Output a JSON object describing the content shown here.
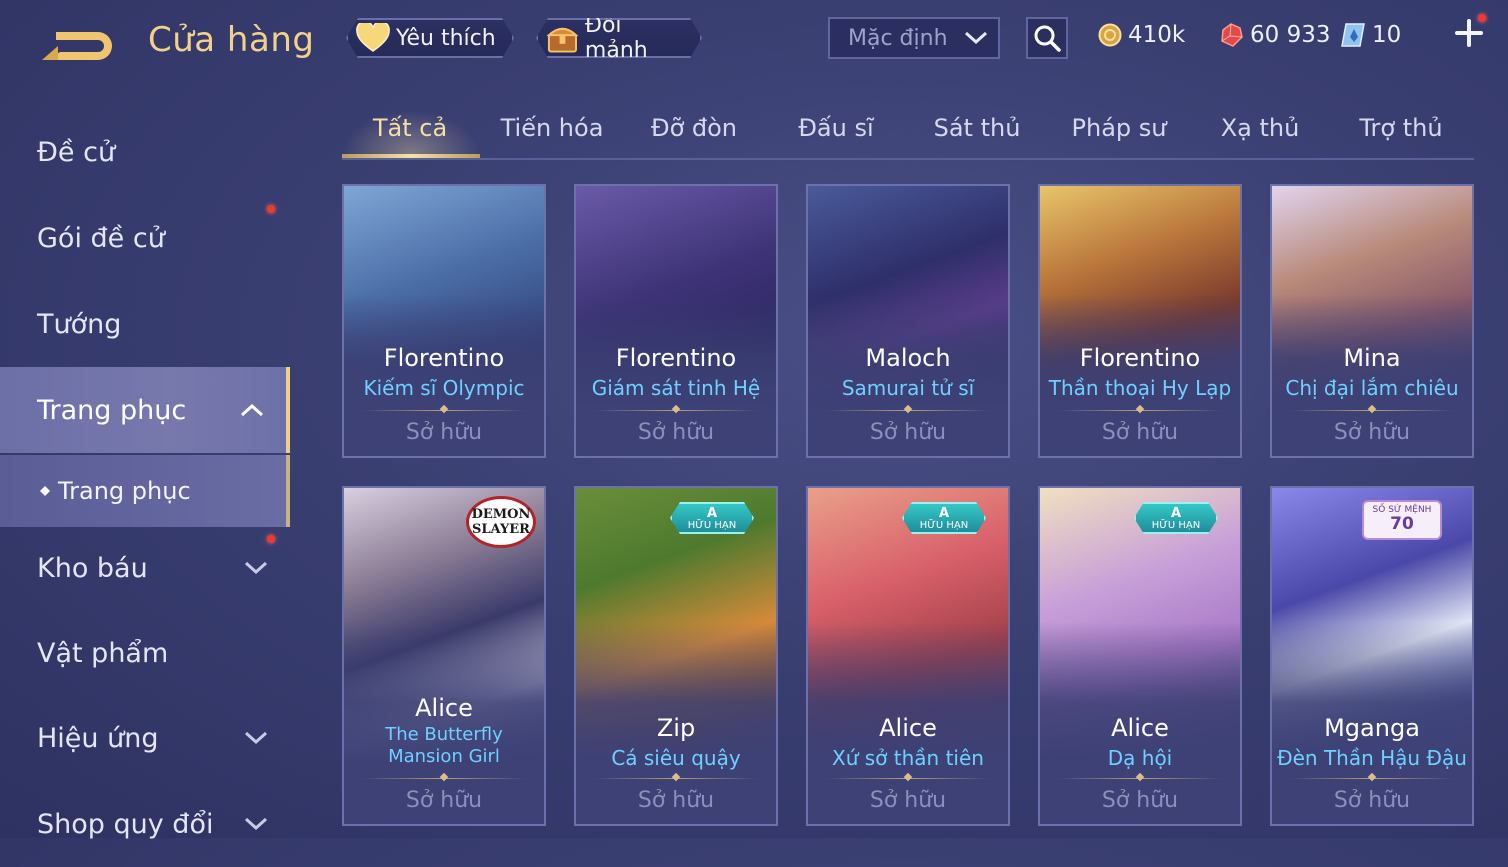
{
  "header": {
    "title": "Cửa hàng",
    "favorite_label": "Yêu thích",
    "shard_label": "Đổi mảnh",
    "sort_selected": "Mặc định",
    "currencies": [
      {
        "name": "gold",
        "value": "410k"
      },
      {
        "name": "ruby",
        "value": "60 933"
      },
      {
        "name": "diamond",
        "value": "10"
      }
    ]
  },
  "sidebar": {
    "items": [
      {
        "label": "Đề cử"
      },
      {
        "label": "Gói đề cử"
      },
      {
        "label": "Tướng"
      },
      {
        "label": "Trang phục"
      },
      {
        "label": "Kho báu"
      },
      {
        "label": "Vật phẩm"
      },
      {
        "label": "Hiệu ứng"
      },
      {
        "label": "Shop quy đổi"
      }
    ],
    "sub_item": "Trang phục"
  },
  "tabs": [
    "Tất cả",
    "Tiến hóa",
    "Đỡ đòn",
    "Đấu sĩ",
    "Sát thủ",
    "Pháp sư",
    "Xạ thủ",
    "Trợ thủ"
  ],
  "cards": [
    {
      "hero": "Florentino",
      "skin": "Kiếm sĩ Olympic",
      "status": "Sở hữu"
    },
    {
      "hero": "Florentino",
      "skin": "Giám sát tinh Hệ",
      "status": "Sở hữu"
    },
    {
      "hero": "Maloch",
      "skin": "Samurai tử sĩ",
      "status": "Sở hữu"
    },
    {
      "hero": "Florentino",
      "skin": "Thần thoại Hy Lạp",
      "status": "Sở hữu"
    },
    {
      "hero": "Mina",
      "skin": "Chị đại lắm chiêu",
      "status": "Sở hữu"
    },
    {
      "hero": "Alice",
      "skin": "The Butterfly Mansion Girl",
      "status": "Sở hữu",
      "badge": "DEMON SLAYER"
    },
    {
      "hero": "Zip",
      "skin": "Cá siêu quậy",
      "status": "Sở hữu",
      "badge_rank": "A",
      "badge_text": "HỮU HẠN"
    },
    {
      "hero": "Alice",
      "skin": "Xứ sở thần tiên",
      "status": "Sở hữu",
      "badge_rank": "A",
      "badge_text": "HỮU HẠN"
    },
    {
      "hero": "Alice",
      "skin": "Dạ hội",
      "status": "Sở hữu",
      "badge_rank": "A",
      "badge_text": "HỮU HẠN"
    },
    {
      "hero": "Mganga",
      "skin": "Đèn Thần Hậu Đậu",
      "status": "Sở hữu",
      "badge_text": "SỐ SỨ MỆNH",
      "badge_number": "70"
    }
  ],
  "colors": {
    "accent_gold": "#f2d28a",
    "skin_name_blue": "#6fd0ff",
    "notification_red": "#f0382c"
  }
}
